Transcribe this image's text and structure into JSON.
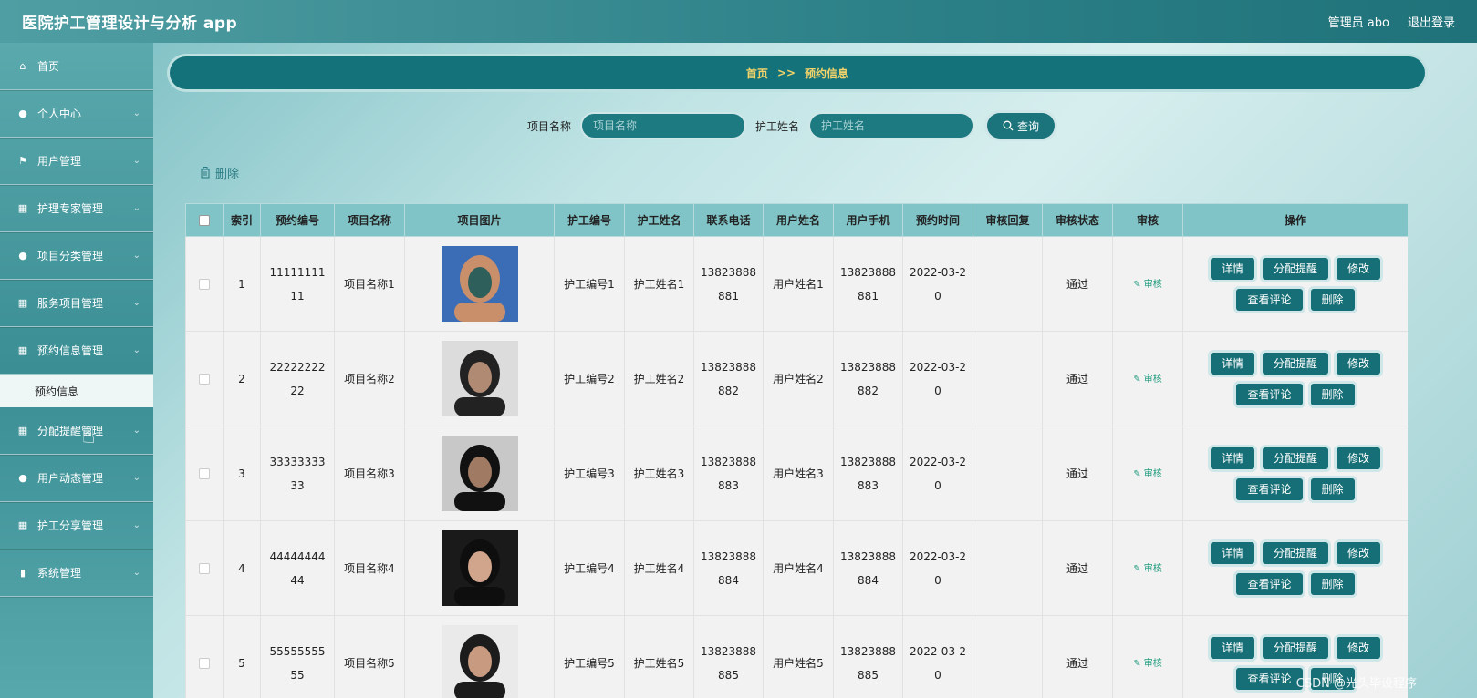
{
  "app": {
    "title": "医院护工管理设计与分析 app"
  },
  "header": {
    "user_label": "管理员 abo",
    "logout_label": "退出登录"
  },
  "sidebar": {
    "items": [
      {
        "label": "首页",
        "icon": "home-icon",
        "glyph": "⌂"
      },
      {
        "label": "个人中心",
        "icon": "user-icon",
        "glyph": "●"
      },
      {
        "label": "用户管理",
        "icon": "flag-icon",
        "glyph": "⚑"
      },
      {
        "label": "护理专家管理",
        "icon": "grid-icon",
        "glyph": "▦"
      },
      {
        "label": "项目分类管理",
        "icon": "pin-icon",
        "glyph": "●"
      },
      {
        "label": "服务项目管理",
        "icon": "grid-icon",
        "glyph": "▦"
      },
      {
        "label": "预约信息管理",
        "icon": "grid-icon",
        "glyph": "▦"
      }
    ],
    "sub_item": "预约信息",
    "items_after": [
      {
        "label": "分配提醒管理",
        "icon": "apps-icon",
        "glyph": "▦"
      },
      {
        "label": "用户动态管理",
        "icon": "user-icon",
        "glyph": "●"
      },
      {
        "label": "护工分享管理",
        "icon": "grid-icon",
        "glyph": "▦"
      },
      {
        "label": "系统管理",
        "icon": "bar-chart-icon",
        "glyph": "▮"
      }
    ]
  },
  "breadcrumb": {
    "home": "首页",
    "sep": ">>",
    "current": "预约信息"
  },
  "search": {
    "project_label": "项目名称",
    "project_placeholder": "项目名称",
    "nurse_label": "护工姓名",
    "nurse_placeholder": "护工姓名",
    "button_label": "查询"
  },
  "toolbar": {
    "delete_label": "删除"
  },
  "table": {
    "headers": [
      "索引",
      "预约编号",
      "项目名称",
      "项目图片",
      "护工编号",
      "护工姓名",
      "联系电话",
      "用户姓名",
      "用户手机",
      "预约时间",
      "审核回复",
      "审核状态",
      "审核",
      "操作"
    ],
    "audit_label": "审核",
    "op_labels": [
      "详情",
      "分配提醒",
      "修改",
      "查看评论",
      "删除"
    ],
    "rows": [
      {
        "index": "1",
        "booking_no": "1111111111",
        "project": "项目名称1",
        "nurse_no": "护工编号1",
        "nurse_name": "护工姓名1",
        "phone": "13823888881",
        "user_name": "用户姓名1",
        "user_phone": "13823888881",
        "time": "2022-03-20",
        "reply": "",
        "status": "通过"
      },
      {
        "index": "2",
        "booking_no": "2222222222",
        "project": "项目名称2",
        "nurse_no": "护工编号2",
        "nurse_name": "护工姓名2",
        "phone": "13823888882",
        "user_name": "用户姓名2",
        "user_phone": "13823888882",
        "time": "2022-03-20",
        "reply": "",
        "status": "通过"
      },
      {
        "index": "3",
        "booking_no": "3333333333",
        "project": "项目名称3",
        "nurse_no": "护工编号3",
        "nurse_name": "护工姓名3",
        "phone": "13823888883",
        "user_name": "用户姓名3",
        "user_phone": "13823888883",
        "time": "2022-03-20",
        "reply": "",
        "status": "通过"
      },
      {
        "index": "4",
        "booking_no": "4444444444",
        "project": "项目名称4",
        "nurse_no": "护工编号4",
        "nurse_name": "护工姓名4",
        "phone": "13823888884",
        "user_name": "用户姓名4",
        "user_phone": "13823888884",
        "time": "2022-03-20",
        "reply": "",
        "status": "通过"
      },
      {
        "index": "5",
        "booking_no": "5555555555",
        "project": "项目名称5",
        "nurse_no": "护工编号5",
        "nurse_name": "护工姓名5",
        "phone": "13823888885",
        "user_name": "用户姓名5",
        "user_phone": "13823888885",
        "time": "2022-03-20",
        "reply": "",
        "status": "通过"
      }
    ]
  },
  "watermark": "CSDN @光头毕设程序",
  "colors": {
    "primary": "#166f76",
    "header_bg": "#80c4c8",
    "accent_text": "#f3d36a"
  }
}
